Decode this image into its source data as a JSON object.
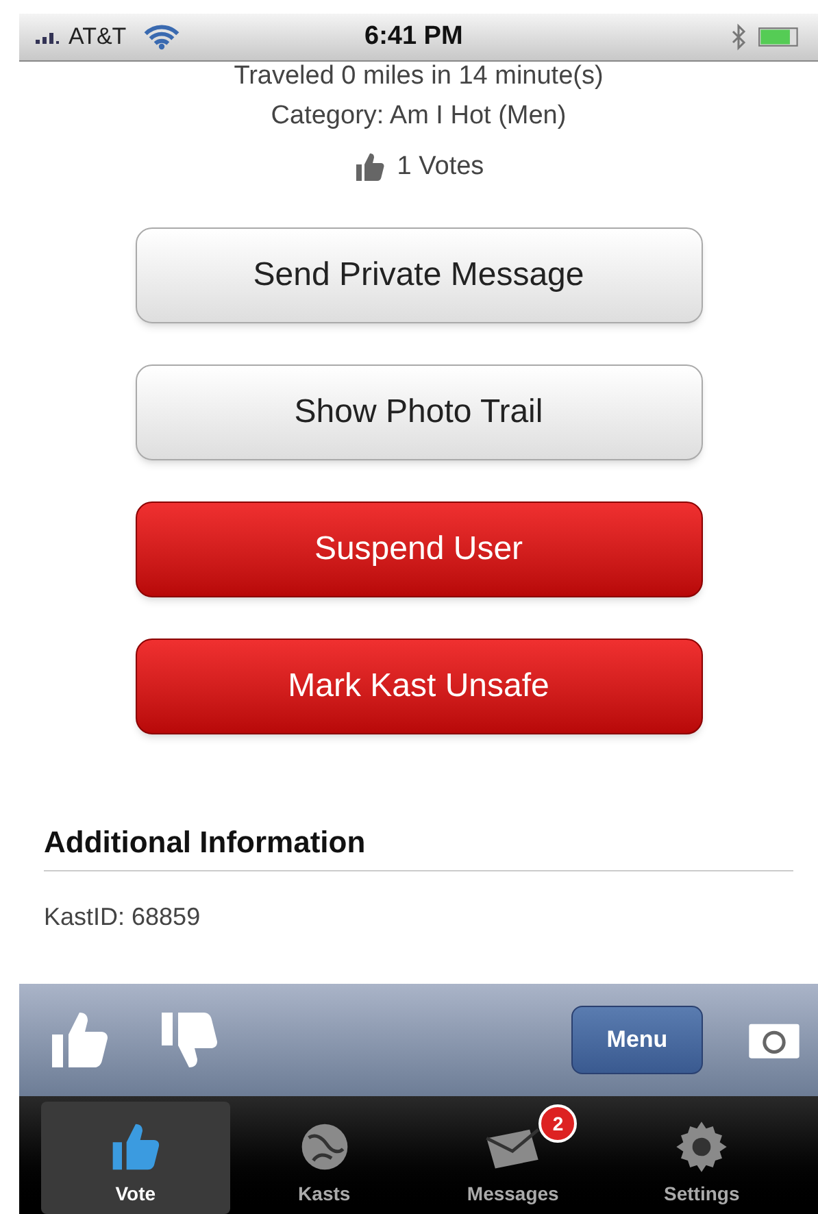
{
  "status_bar": {
    "carrier": "AT&T",
    "time": "6:41 PM"
  },
  "details": {
    "traveled": "Traveled 0 miles in 14 minute(s)",
    "category": "Category: Am I Hot (Men)",
    "votes": "1 Votes"
  },
  "buttons": [
    {
      "label": "Send Private Message",
      "kind": "default"
    },
    {
      "label": "Show Photo Trail",
      "kind": "default"
    },
    {
      "label": "Suspend User",
      "kind": "danger"
    },
    {
      "label": "Mark Kast Unsafe",
      "kind": "danger"
    }
  ],
  "section": {
    "title": "Additional Information",
    "rows": [
      "KastID: 68859"
    ]
  },
  "toolbar": {
    "menu": "Menu"
  },
  "tab_bar": [
    {
      "label": "Vote",
      "selected": true,
      "kind": "thumb"
    },
    {
      "label": "Kasts",
      "selected": false,
      "kind": "globe"
    },
    {
      "label": "Messages",
      "selected": false,
      "kind": "mail",
      "badge": "2"
    },
    {
      "label": "Settings",
      "selected": false,
      "kind": "gear"
    }
  ]
}
